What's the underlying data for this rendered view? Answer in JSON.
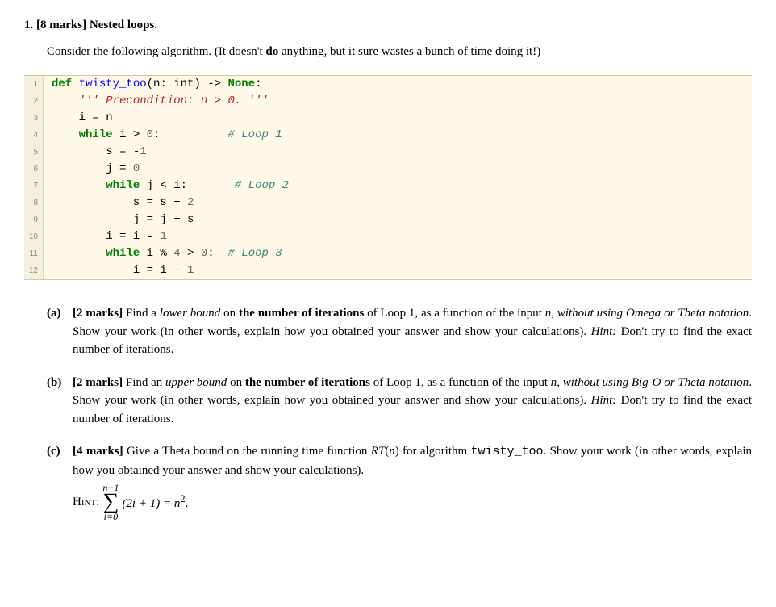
{
  "q": {
    "number": "1.",
    "marks": "[8 marks]",
    "title": "Nested loops.",
    "intro_pre": "Consider the following algorithm. (It doesn't ",
    "intro_bold": "do",
    "intro_post": " anything, but it sure wastes a bunch of time doing it!)"
  },
  "code": {
    "lines": [
      1,
      2,
      3,
      4,
      5,
      6,
      7,
      8,
      9,
      10,
      11,
      12
    ],
    "l1": {
      "def": "def",
      "name": " twisty_too",
      "sig": "(n: ",
      "int": "int",
      "sig2": ") -> ",
      "none": "None",
      "colon": ":"
    },
    "l2": {
      "indent": "    ",
      "doc": "''' Precondition: n > 0. '''"
    },
    "l3": {
      "indent": "    ",
      "text": "i = n"
    },
    "l4": {
      "indent": "    ",
      "kw": "while",
      "cond": " i > ",
      "zero": "0",
      "colon": ":",
      "pad": "          ",
      "comment": "# Loop 1"
    },
    "l5": {
      "indent": "        ",
      "text": "s = -",
      "one": "1"
    },
    "l6": {
      "indent": "        ",
      "text": "j = ",
      "zero": "0"
    },
    "l7": {
      "indent": "        ",
      "kw": "while",
      "cond": " j < i:",
      "pad": "       ",
      "comment": "# Loop 2"
    },
    "l8": {
      "indent": "            ",
      "text": "s = s + ",
      "two": "2"
    },
    "l9": {
      "indent": "            ",
      "text": "j = j + s"
    },
    "l10": {
      "indent": "        ",
      "text": "i = i - ",
      "one": "1"
    },
    "l11": {
      "indent": "        ",
      "kw": "while",
      "cond": " i % ",
      "four": "4",
      "cond2": " > ",
      "zero": "0",
      "colon": ":",
      "pad": "  ",
      "comment": "# Loop 3"
    },
    "l12": {
      "indent": "            ",
      "text": "i = i - ",
      "one": "1"
    }
  },
  "a": {
    "label": "(a)",
    "marks": "[2 marks]",
    "t1": " Find a ",
    "i1": "lower bound",
    "t2": " on ",
    "b1": "the number of iterations",
    "t3": " of Loop 1, as a function of the input ",
    "i2": "n",
    "t4": ", ",
    "i3": "without using Omega or Theta notation",
    "t5": ". Show your work (in other words, explain how you obtained your answer and show your calculations). ",
    "i4": "Hint:",
    "t6": " Don't try to find the exact number of iterations."
  },
  "b": {
    "label": "(b)",
    "marks": "[2 marks]",
    "t1": " Find an ",
    "i1": "upper bound",
    "t2": " on ",
    "b1": "the number of iterations",
    "t3": " of Loop 1, as a function of the input ",
    "i2": "n",
    "t4": ", ",
    "i3": "without using Big-O or Theta notation",
    "t5": ". Show your work (in other words, explain how you obtained your answer and show your calculations). ",
    "i4": "Hint:",
    "t6": " Don't try to find the exact number of iterations."
  },
  "c": {
    "label": "(c)",
    "marks": "[4 marks]",
    "t1": " Give a Theta bound on the running time function ",
    "i1": "RT",
    "t2": "(",
    "i2": "n",
    "t3": ") for algorithm ",
    "tt1": "twisty_too",
    "t4": ". Show your work (in other words, explain how you obtained your answer and show your calculations).",
    "hint_label": "Hint:",
    "sum_upper": "n−1",
    "sum_lower": "i=0",
    "sum_body": "(2i + 1) = n",
    "sum_exp": "2",
    "sum_end": "."
  },
  "sigma": "∑"
}
